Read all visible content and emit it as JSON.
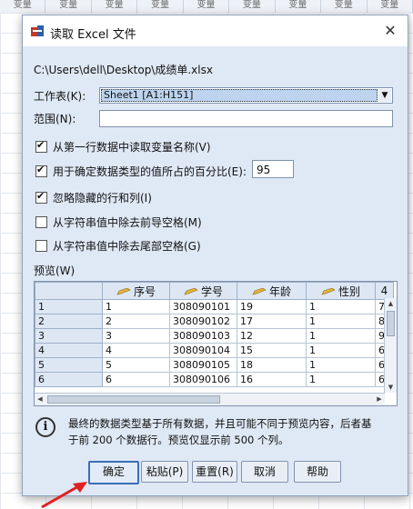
{
  "background": {
    "header_cells": [
      "变量",
      "变量",
      "变量",
      "变量",
      "变量",
      "变量",
      "变量",
      "变量",
      "变量"
    ]
  },
  "dialog": {
    "title": "读取 Excel 文件",
    "file_path": "C:\\Users\\dell\\Desktop\\成绩单.xlsx",
    "worksheet": {
      "label": "工作表(K):",
      "value": "Sheet1 [A1:H151]"
    },
    "range": {
      "label": "范围(N):",
      "value": ""
    },
    "options": [
      {
        "label": "从第一行数据中读取变量名称(V)",
        "checked": true
      },
      {
        "label": "用于确定数据类型的值所占的百分比(E):",
        "checked": true
      },
      {
        "label": "忽略隐藏的行和列(I)",
        "checked": true
      },
      {
        "label": "从字符串值中除去前导空格(M)",
        "checked": false
      },
      {
        "label": "从字符串值中除去尾部空格(G)",
        "checked": false
      }
    ],
    "percent_value": "95",
    "preview": {
      "label": "预览(W)",
      "columns": [
        "序号",
        "学号",
        "年龄",
        "性别",
        "4"
      ],
      "rows": [
        {
          "num": "1",
          "cells": [
            "1",
            "308090101",
            "19",
            "1",
            "7"
          ]
        },
        {
          "num": "2",
          "cells": [
            "2",
            "308090102",
            "17",
            "1",
            "8"
          ]
        },
        {
          "num": "3",
          "cells": [
            "3",
            "308090103",
            "12",
            "1",
            "9"
          ]
        },
        {
          "num": "4",
          "cells": [
            "4",
            "308090104",
            "15",
            "1",
            "6"
          ]
        },
        {
          "num": "5",
          "cells": [
            "5",
            "308090105",
            "18",
            "1",
            "6"
          ]
        },
        {
          "num": "6",
          "cells": [
            "6",
            "308090106",
            "16",
            "1",
            "6"
          ]
        }
      ]
    },
    "info": {
      "icon": "info-icon",
      "line1": "最终的数据类型基于所有数据，并且可能不同于预览内容，后者基",
      "line2": "于前 200 个数据行。预览仅显示前 500 个列。"
    },
    "buttons": {
      "ok": "确定",
      "paste": "粘贴(P)",
      "reset": "重置(R)",
      "cancel": "取消",
      "help": "帮助"
    }
  }
}
